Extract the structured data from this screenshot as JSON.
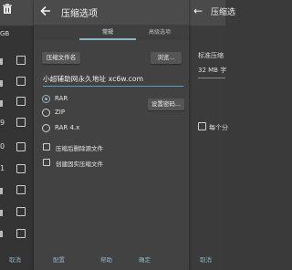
{
  "dialog": {
    "title": "压缩选项",
    "tabs": [
      {
        "label": "常规",
        "active": true
      },
      {
        "label": "高级选项",
        "active": false
      }
    ],
    "archive_name_button": "压缩文件名",
    "browse_button": "浏览...",
    "archive_name_value": "小超辅助网永久地址 xc6w.com",
    "formats": [
      {
        "label": "RAR",
        "checked": true
      },
      {
        "label": "ZIP",
        "checked": false
      },
      {
        "label": "RAR 4.x",
        "checked": false
      }
    ],
    "set_password_button": "设置密码...",
    "options": [
      {
        "label": "压缩后删除源文件",
        "checked": false
      },
      {
        "label": "创建固实压缩文件",
        "checked": false
      }
    ]
  },
  "footer": {
    "cancel_left": "取消",
    "configure": "配置",
    "help": "帮助",
    "ok": "确定",
    "cancel_right": "取消"
  },
  "background": {
    "left_top_label": "GB",
    "left_numbers": [
      "9",
      "0",
      "1"
    ],
    "right_title": "压缩选",
    "right_standard": "标准压缩",
    "right_size": "32 MB 字",
    "right_each": "每个分"
  },
  "colors": {
    "accent": "#8ab4c6",
    "dialog_bg": "#424242",
    "toolbar_bg": "#4b4b4b"
  }
}
